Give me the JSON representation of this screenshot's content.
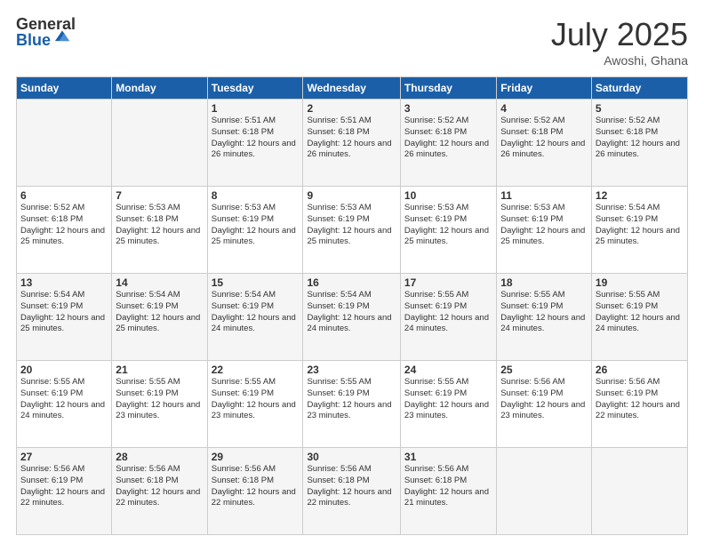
{
  "logo": {
    "general": "General",
    "blue": "Blue"
  },
  "title": {
    "month": "July 2025",
    "location": "Awoshi, Ghana"
  },
  "headers": [
    "Sunday",
    "Monday",
    "Tuesday",
    "Wednesday",
    "Thursday",
    "Friday",
    "Saturday"
  ],
  "weeks": [
    [
      {
        "day": "",
        "sunrise": "",
        "sunset": "",
        "daylight": ""
      },
      {
        "day": "",
        "sunrise": "",
        "sunset": "",
        "daylight": ""
      },
      {
        "day": "1",
        "sunrise": "Sunrise: 5:51 AM",
        "sunset": "Sunset: 6:18 PM",
        "daylight": "Daylight: 12 hours and 26 minutes."
      },
      {
        "day": "2",
        "sunrise": "Sunrise: 5:51 AM",
        "sunset": "Sunset: 6:18 PM",
        "daylight": "Daylight: 12 hours and 26 minutes."
      },
      {
        "day": "3",
        "sunrise": "Sunrise: 5:52 AM",
        "sunset": "Sunset: 6:18 PM",
        "daylight": "Daylight: 12 hours and 26 minutes."
      },
      {
        "day": "4",
        "sunrise": "Sunrise: 5:52 AM",
        "sunset": "Sunset: 6:18 PM",
        "daylight": "Daylight: 12 hours and 26 minutes."
      },
      {
        "day": "5",
        "sunrise": "Sunrise: 5:52 AM",
        "sunset": "Sunset: 6:18 PM",
        "daylight": "Daylight: 12 hours and 26 minutes."
      }
    ],
    [
      {
        "day": "6",
        "sunrise": "Sunrise: 5:52 AM",
        "sunset": "Sunset: 6:18 PM",
        "daylight": "Daylight: 12 hours and 25 minutes."
      },
      {
        "day": "7",
        "sunrise": "Sunrise: 5:53 AM",
        "sunset": "Sunset: 6:18 PM",
        "daylight": "Daylight: 12 hours and 25 minutes."
      },
      {
        "day": "8",
        "sunrise": "Sunrise: 5:53 AM",
        "sunset": "Sunset: 6:19 PM",
        "daylight": "Daylight: 12 hours and 25 minutes."
      },
      {
        "day": "9",
        "sunrise": "Sunrise: 5:53 AM",
        "sunset": "Sunset: 6:19 PM",
        "daylight": "Daylight: 12 hours and 25 minutes."
      },
      {
        "day": "10",
        "sunrise": "Sunrise: 5:53 AM",
        "sunset": "Sunset: 6:19 PM",
        "daylight": "Daylight: 12 hours and 25 minutes."
      },
      {
        "day": "11",
        "sunrise": "Sunrise: 5:53 AM",
        "sunset": "Sunset: 6:19 PM",
        "daylight": "Daylight: 12 hours and 25 minutes."
      },
      {
        "day": "12",
        "sunrise": "Sunrise: 5:54 AM",
        "sunset": "Sunset: 6:19 PM",
        "daylight": "Daylight: 12 hours and 25 minutes."
      }
    ],
    [
      {
        "day": "13",
        "sunrise": "Sunrise: 5:54 AM",
        "sunset": "Sunset: 6:19 PM",
        "daylight": "Daylight: 12 hours and 25 minutes."
      },
      {
        "day": "14",
        "sunrise": "Sunrise: 5:54 AM",
        "sunset": "Sunset: 6:19 PM",
        "daylight": "Daylight: 12 hours and 25 minutes."
      },
      {
        "day": "15",
        "sunrise": "Sunrise: 5:54 AM",
        "sunset": "Sunset: 6:19 PM",
        "daylight": "Daylight: 12 hours and 24 minutes."
      },
      {
        "day": "16",
        "sunrise": "Sunrise: 5:54 AM",
        "sunset": "Sunset: 6:19 PM",
        "daylight": "Daylight: 12 hours and 24 minutes."
      },
      {
        "day": "17",
        "sunrise": "Sunrise: 5:55 AM",
        "sunset": "Sunset: 6:19 PM",
        "daylight": "Daylight: 12 hours and 24 minutes."
      },
      {
        "day": "18",
        "sunrise": "Sunrise: 5:55 AM",
        "sunset": "Sunset: 6:19 PM",
        "daylight": "Daylight: 12 hours and 24 minutes."
      },
      {
        "day": "19",
        "sunrise": "Sunrise: 5:55 AM",
        "sunset": "Sunset: 6:19 PM",
        "daylight": "Daylight: 12 hours and 24 minutes."
      }
    ],
    [
      {
        "day": "20",
        "sunrise": "Sunrise: 5:55 AM",
        "sunset": "Sunset: 6:19 PM",
        "daylight": "Daylight: 12 hours and 24 minutes."
      },
      {
        "day": "21",
        "sunrise": "Sunrise: 5:55 AM",
        "sunset": "Sunset: 6:19 PM",
        "daylight": "Daylight: 12 hours and 23 minutes."
      },
      {
        "day": "22",
        "sunrise": "Sunrise: 5:55 AM",
        "sunset": "Sunset: 6:19 PM",
        "daylight": "Daylight: 12 hours and 23 minutes."
      },
      {
        "day": "23",
        "sunrise": "Sunrise: 5:55 AM",
        "sunset": "Sunset: 6:19 PM",
        "daylight": "Daylight: 12 hours and 23 minutes."
      },
      {
        "day": "24",
        "sunrise": "Sunrise: 5:55 AM",
        "sunset": "Sunset: 6:19 PM",
        "daylight": "Daylight: 12 hours and 23 minutes."
      },
      {
        "day": "25",
        "sunrise": "Sunrise: 5:56 AM",
        "sunset": "Sunset: 6:19 PM",
        "daylight": "Daylight: 12 hours and 23 minutes."
      },
      {
        "day": "26",
        "sunrise": "Sunrise: 5:56 AM",
        "sunset": "Sunset: 6:19 PM",
        "daylight": "Daylight: 12 hours and 22 minutes."
      }
    ],
    [
      {
        "day": "27",
        "sunrise": "Sunrise: 5:56 AM",
        "sunset": "Sunset: 6:19 PM",
        "daylight": "Daylight: 12 hours and 22 minutes."
      },
      {
        "day": "28",
        "sunrise": "Sunrise: 5:56 AM",
        "sunset": "Sunset: 6:18 PM",
        "daylight": "Daylight: 12 hours and 22 minutes."
      },
      {
        "day": "29",
        "sunrise": "Sunrise: 5:56 AM",
        "sunset": "Sunset: 6:18 PM",
        "daylight": "Daylight: 12 hours and 22 minutes."
      },
      {
        "day": "30",
        "sunrise": "Sunrise: 5:56 AM",
        "sunset": "Sunset: 6:18 PM",
        "daylight": "Daylight: 12 hours and 22 minutes."
      },
      {
        "day": "31",
        "sunrise": "Sunrise: 5:56 AM",
        "sunset": "Sunset: 6:18 PM",
        "daylight": "Daylight: 12 hours and 21 minutes."
      },
      {
        "day": "",
        "sunrise": "",
        "sunset": "",
        "daylight": ""
      },
      {
        "day": "",
        "sunrise": "",
        "sunset": "",
        "daylight": ""
      }
    ]
  ]
}
